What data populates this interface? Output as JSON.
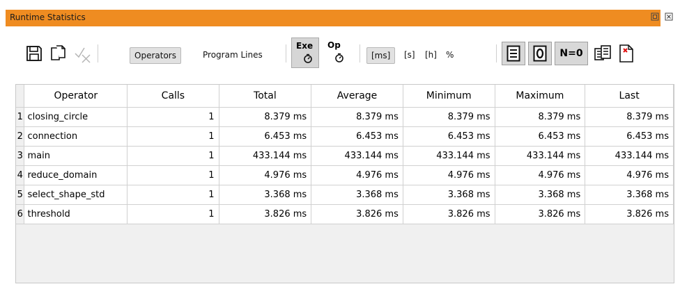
{
  "window": {
    "title": "Runtime Statistics",
    "accent": "#ef8c21",
    "buttons": [
      "restore-icon",
      "close-icon"
    ]
  },
  "toolbar": {
    "save_icon": "save-icon",
    "copy_icon": "copy-icon",
    "clear_icon": "clear-checkmark-icon",
    "operators_label": "Operators",
    "program_lines_label": "Program Lines",
    "exe_label": "Exe",
    "op_label": "Op",
    "unit_ms": "[ms]",
    "unit_s": "[s]",
    "unit_h": "[h]",
    "unit_percent": "%",
    "n_zero_label": "N=0",
    "list_icon": "list-icon",
    "zero_icon": "zero-icon",
    "pages_icon": "multi-page-icon",
    "close_doc_icon": "close-document-icon"
  },
  "table": {
    "columns": [
      "Operator",
      "Calls",
      "Total",
      "Average",
      "Minimum",
      "Maximum",
      "Last"
    ],
    "rows": [
      {
        "index": "1",
        "operator": "closing_circle",
        "calls": "1",
        "total": "8.379 ms",
        "average": "8.379 ms",
        "minimum": "8.379 ms",
        "maximum": "8.379 ms",
        "last": "8.379 ms"
      },
      {
        "index": "2",
        "operator": "connection",
        "calls": "1",
        "total": "6.453 ms",
        "average": "6.453 ms",
        "minimum": "6.453 ms",
        "maximum": "6.453 ms",
        "last": "6.453 ms"
      },
      {
        "index": "3",
        "operator": "main",
        "calls": "1",
        "total": "433.144 ms",
        "average": "433.144 ms",
        "minimum": "433.144 ms",
        "maximum": "433.144 ms",
        "last": "433.144 ms"
      },
      {
        "index": "4",
        "operator": "reduce_domain",
        "calls": "1",
        "total": "4.976 ms",
        "average": "4.976 ms",
        "minimum": "4.976 ms",
        "maximum": "4.976 ms",
        "last": "4.976 ms"
      },
      {
        "index": "5",
        "operator": "select_shape_std",
        "calls": "1",
        "total": "3.368 ms",
        "average": "3.368 ms",
        "minimum": "3.368 ms",
        "maximum": "3.368 ms",
        "last": "3.368 ms"
      },
      {
        "index": "6",
        "operator": "threshold",
        "calls": "1",
        "total": "3.826 ms",
        "average": "3.826 ms",
        "minimum": "3.826 ms",
        "maximum": "3.826 ms",
        "last": "3.826 ms"
      }
    ]
  }
}
